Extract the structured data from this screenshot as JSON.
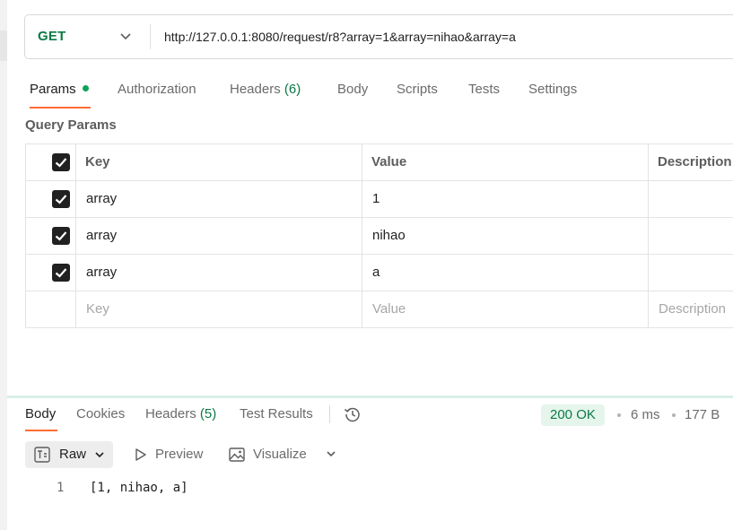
{
  "request": {
    "method": "GET",
    "url": "http://127.0.0.1:8080/request/r8?array=1&array=nihao&array=a"
  },
  "request_tabs": [
    {
      "label": "Params",
      "dot": true
    },
    {
      "label": "Authorization"
    },
    {
      "label": "Headers",
      "count": "(6)"
    },
    {
      "label": "Body"
    },
    {
      "label": "Scripts"
    },
    {
      "label": "Tests"
    },
    {
      "label": "Settings"
    }
  ],
  "query_params": {
    "title": "Query Params",
    "headers": {
      "key": "Key",
      "value": "Value",
      "description": "Description"
    },
    "rows": [
      {
        "key": "array",
        "value": "1",
        "checked": true
      },
      {
        "key": "array",
        "value": "nihao",
        "checked": true
      },
      {
        "key": "array",
        "value": "a",
        "checked": true
      }
    ],
    "placeholder": {
      "key": "Key",
      "value": "Value",
      "description": "Description"
    }
  },
  "response_tabs": [
    {
      "label": "Body"
    },
    {
      "label": "Cookies"
    },
    {
      "label": "Headers",
      "count": "(5)"
    },
    {
      "label": "Test Results"
    }
  ],
  "response_meta": {
    "status": "200 OK",
    "time": "6 ms",
    "size": "177 B"
  },
  "viewer": {
    "format": "Raw",
    "preview_label": "Preview",
    "visualize_label": "Visualize"
  },
  "response_body": {
    "lines": [
      {
        "number": "1",
        "text": "[1, nihao, a]"
      }
    ]
  },
  "colors": {
    "accent": "#ff6c37",
    "method_get": "#0a7a45",
    "status_bg": "#e5f5ec"
  }
}
